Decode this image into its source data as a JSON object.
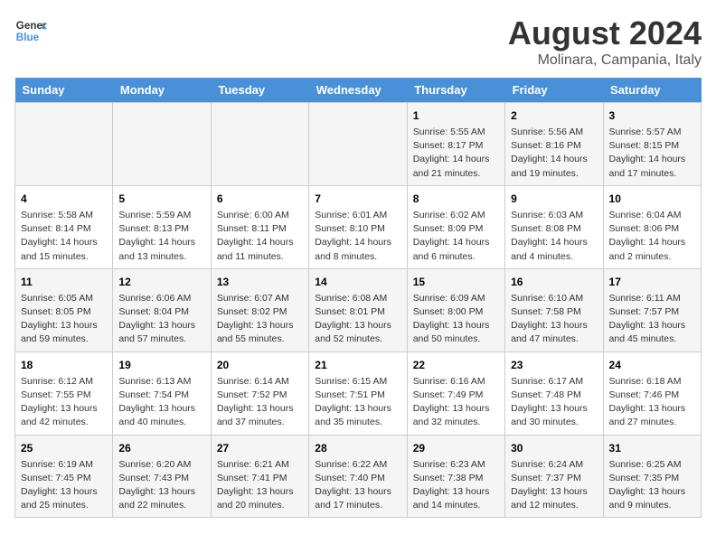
{
  "header": {
    "logo_line1": "General",
    "logo_line2": "Blue",
    "main_title": "August 2024",
    "subtitle": "Molinara, Campania, Italy"
  },
  "weekdays": [
    "Sunday",
    "Monday",
    "Tuesday",
    "Wednesday",
    "Thursday",
    "Friday",
    "Saturday"
  ],
  "weeks": [
    [
      {
        "day": "",
        "content": ""
      },
      {
        "day": "",
        "content": ""
      },
      {
        "day": "",
        "content": ""
      },
      {
        "day": "",
        "content": ""
      },
      {
        "day": "1",
        "content": "Sunrise: 5:55 AM\nSunset: 8:17 PM\nDaylight: 14 hours\nand 21 minutes."
      },
      {
        "day": "2",
        "content": "Sunrise: 5:56 AM\nSunset: 8:16 PM\nDaylight: 14 hours\nand 19 minutes."
      },
      {
        "day": "3",
        "content": "Sunrise: 5:57 AM\nSunset: 8:15 PM\nDaylight: 14 hours\nand 17 minutes."
      }
    ],
    [
      {
        "day": "4",
        "content": "Sunrise: 5:58 AM\nSunset: 8:14 PM\nDaylight: 14 hours\nand 15 minutes."
      },
      {
        "day": "5",
        "content": "Sunrise: 5:59 AM\nSunset: 8:13 PM\nDaylight: 14 hours\nand 13 minutes."
      },
      {
        "day": "6",
        "content": "Sunrise: 6:00 AM\nSunset: 8:11 PM\nDaylight: 14 hours\nand 11 minutes."
      },
      {
        "day": "7",
        "content": "Sunrise: 6:01 AM\nSunset: 8:10 PM\nDaylight: 14 hours\nand 8 minutes."
      },
      {
        "day": "8",
        "content": "Sunrise: 6:02 AM\nSunset: 8:09 PM\nDaylight: 14 hours\nand 6 minutes."
      },
      {
        "day": "9",
        "content": "Sunrise: 6:03 AM\nSunset: 8:08 PM\nDaylight: 14 hours\nand 4 minutes."
      },
      {
        "day": "10",
        "content": "Sunrise: 6:04 AM\nSunset: 8:06 PM\nDaylight: 14 hours\nand 2 minutes."
      }
    ],
    [
      {
        "day": "11",
        "content": "Sunrise: 6:05 AM\nSunset: 8:05 PM\nDaylight: 13 hours\nand 59 minutes."
      },
      {
        "day": "12",
        "content": "Sunrise: 6:06 AM\nSunset: 8:04 PM\nDaylight: 13 hours\nand 57 minutes."
      },
      {
        "day": "13",
        "content": "Sunrise: 6:07 AM\nSunset: 8:02 PM\nDaylight: 13 hours\nand 55 minutes."
      },
      {
        "day": "14",
        "content": "Sunrise: 6:08 AM\nSunset: 8:01 PM\nDaylight: 13 hours\nand 52 minutes."
      },
      {
        "day": "15",
        "content": "Sunrise: 6:09 AM\nSunset: 8:00 PM\nDaylight: 13 hours\nand 50 minutes."
      },
      {
        "day": "16",
        "content": "Sunrise: 6:10 AM\nSunset: 7:58 PM\nDaylight: 13 hours\nand 47 minutes."
      },
      {
        "day": "17",
        "content": "Sunrise: 6:11 AM\nSunset: 7:57 PM\nDaylight: 13 hours\nand 45 minutes."
      }
    ],
    [
      {
        "day": "18",
        "content": "Sunrise: 6:12 AM\nSunset: 7:55 PM\nDaylight: 13 hours\nand 42 minutes."
      },
      {
        "day": "19",
        "content": "Sunrise: 6:13 AM\nSunset: 7:54 PM\nDaylight: 13 hours\nand 40 minutes."
      },
      {
        "day": "20",
        "content": "Sunrise: 6:14 AM\nSunset: 7:52 PM\nDaylight: 13 hours\nand 37 minutes."
      },
      {
        "day": "21",
        "content": "Sunrise: 6:15 AM\nSunset: 7:51 PM\nDaylight: 13 hours\nand 35 minutes."
      },
      {
        "day": "22",
        "content": "Sunrise: 6:16 AM\nSunset: 7:49 PM\nDaylight: 13 hours\nand 32 minutes."
      },
      {
        "day": "23",
        "content": "Sunrise: 6:17 AM\nSunset: 7:48 PM\nDaylight: 13 hours\nand 30 minutes."
      },
      {
        "day": "24",
        "content": "Sunrise: 6:18 AM\nSunset: 7:46 PM\nDaylight: 13 hours\nand 27 minutes."
      }
    ],
    [
      {
        "day": "25",
        "content": "Sunrise: 6:19 AM\nSunset: 7:45 PM\nDaylight: 13 hours\nand 25 minutes."
      },
      {
        "day": "26",
        "content": "Sunrise: 6:20 AM\nSunset: 7:43 PM\nDaylight: 13 hours\nand 22 minutes."
      },
      {
        "day": "27",
        "content": "Sunrise: 6:21 AM\nSunset: 7:41 PM\nDaylight: 13 hours\nand 20 minutes."
      },
      {
        "day": "28",
        "content": "Sunrise: 6:22 AM\nSunset: 7:40 PM\nDaylight: 13 hours\nand 17 minutes."
      },
      {
        "day": "29",
        "content": "Sunrise: 6:23 AM\nSunset: 7:38 PM\nDaylight: 13 hours\nand 14 minutes."
      },
      {
        "day": "30",
        "content": "Sunrise: 6:24 AM\nSunset: 7:37 PM\nDaylight: 13 hours\nand 12 minutes."
      },
      {
        "day": "31",
        "content": "Sunrise: 6:25 AM\nSunset: 7:35 PM\nDaylight: 13 hours\nand 9 minutes."
      }
    ]
  ]
}
